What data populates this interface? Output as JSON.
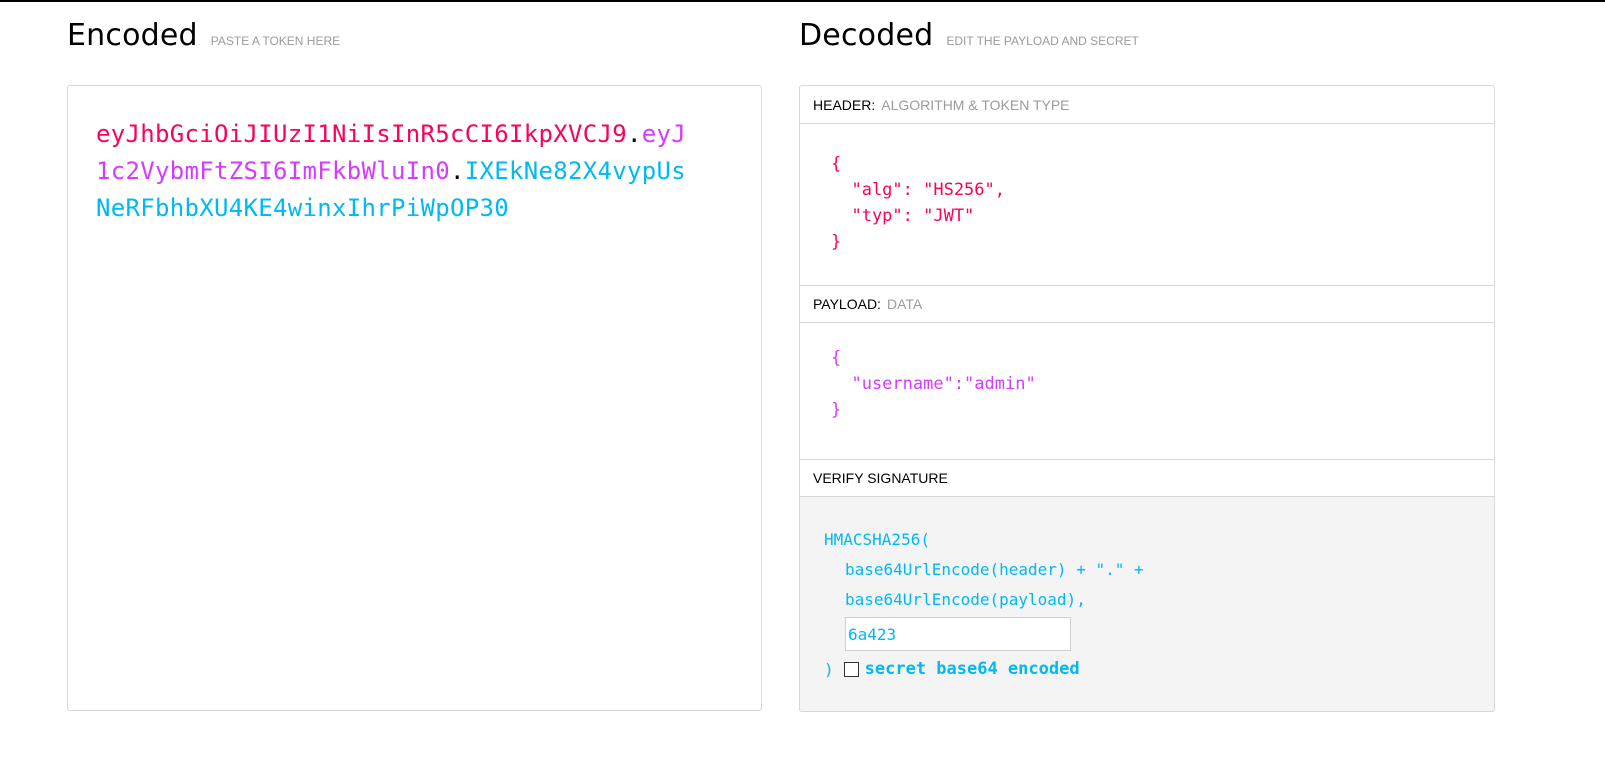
{
  "encoded": {
    "title": "Encoded",
    "subtitle": "PASTE A TOKEN HERE",
    "token": {
      "header": "eyJhbGciOiJIUzI1NiIsInR5cCI6IkpXVCJ9",
      "payload": "eyJ1c2VybmFtZSI6ImFkbWluIn0",
      "signature": "IXEkNe82X4vypUsNeRFbhbXU4KE4winxIhrPiWpOP30",
      "separator": "."
    }
  },
  "decoded": {
    "title": "Decoded",
    "subtitle": "EDIT THE PAYLOAD AND SECRET",
    "header_section": {
      "label": "HEADER:",
      "sublabel": "ALGORITHM & TOKEN TYPE",
      "json": "{\n  \"alg\": \"HS256\",\n  \"typ\": \"JWT\"\n}"
    },
    "payload_section": {
      "label": "PAYLOAD:",
      "sublabel": "DATA",
      "json": "{\n  \"username\":\"admin\"\n}"
    },
    "verify_section": {
      "label": "VERIFY SIGNATURE",
      "func_open": "HMACSHA256(",
      "line1": "base64UrlEncode(header) + \".\" +",
      "line2": "base64UrlEncode(payload),",
      "secret_value": "6a423",
      "func_close": ")",
      "checkbox_label": "secret base64 encoded",
      "checkbox_checked": false
    }
  },
  "colors": {
    "header": "#fb015b",
    "payload": "#d63aff",
    "signature": "#00b9f1"
  }
}
